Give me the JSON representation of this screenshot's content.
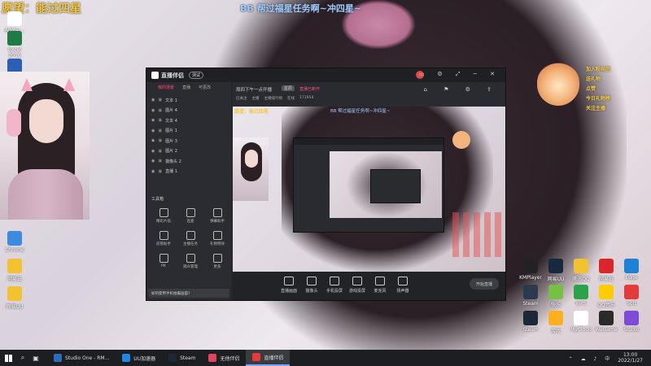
{
  "stream_overlay": {
    "wish_text": "愿望：能过四星",
    "banner_text": "BB 帮过福星任务啊~冲四星~",
    "follower_badges": [
      "加入粉丝团",
      "送礼物",
      "点赞",
      "今日礼物榜",
      "关注主播"
    ]
  },
  "desktop_icons_left": [
    {
      "label": "Adobe...",
      "color": "#ffffff"
    },
    {
      "label": "Excel 2016",
      "color": "#1f7a43"
    },
    {
      "label": "Word",
      "color": "#2b5fb5"
    },
    {
      "label": "Chrome",
      "color": "#3d8be0"
    },
    {
      "label": "网易云",
      "color": "#f3c230"
    },
    {
      "label": "网易UU",
      "color": "#f3c230"
    }
  ],
  "app": {
    "logo_text": "直播伴侣",
    "version_badge": "测试",
    "left_tabs": [
      "我的场景",
      "直播",
      "可更改"
    ],
    "sources": [
      "文本 1",
      "图片 4",
      "文本 4",
      "图片 1",
      "图片 3",
      "图片 2",
      "摄像头 2",
      "直播 1"
    ],
    "toolbox_label": "工具箱",
    "tools": [
      "精彩片段",
      "连麦",
      "弹幕助手",
      "房管助手",
      "主播任务",
      "礼物特效",
      "PK",
      "观众管理",
      "更多"
    ],
    "notice": "如何使用手机拍摄画面?",
    "room_title": "周四下午一点开播",
    "room_tag": "星辰",
    "room_status": "直播已断开",
    "room_stats": [
      "已关注",
      "主播",
      "主播排行榜",
      "在线",
      "171954"
    ],
    "bottom_buttons": [
      "直播画面",
      "摄像头",
      "手机投屏",
      "游戏投屏",
      "麦克风",
      "扬声器"
    ],
    "start_button": "开始直播"
  },
  "desktop_icons_right": [
    {
      "label": "KMPlayer",
      "color": "#222222"
    },
    {
      "label": "网易UU",
      "color": "#17293f"
    },
    {
      "label": "腾讯QQ",
      "color": "#f2c230"
    },
    {
      "label": "网易云",
      "color": "#d9252c"
    },
    {
      "label": "Edge",
      "color": "#1b82d6"
    },
    {
      "label": "Steam",
      "color": "#2a3b50"
    },
    {
      "label": "快乐",
      "color": "#76c043"
    },
    {
      "label": "WPS",
      "color": "#2aa34a"
    },
    {
      "label": "QQ音乐",
      "color": "#ffcc00"
    },
    {
      "label": "Soft",
      "color": "#e53a3a"
    },
    {
      "label": "Steam",
      "color": "#1b2838"
    },
    {
      "label": "游戏",
      "color": "#ffb020"
    },
    {
      "label": "MyCloud",
      "color": "#ffffff"
    },
    {
      "label": "WeGame",
      "color": "#2a2a2a"
    },
    {
      "label": "Studio",
      "color": "#7b4bd8"
    }
  ],
  "taskbar": {
    "items": [
      {
        "label": "Studio One - RM...",
        "color": "#2a6ebd",
        "active": false
      },
      {
        "label": "UU加速器",
        "color": "#1e88e5",
        "active": false
      },
      {
        "label": "Steam",
        "color": "#1b2838",
        "active": false
      },
      {
        "label": "无他伴侣",
        "color": "#e0455a",
        "active": false
      },
      {
        "label": "直播伴侣",
        "color": "#e53a3a",
        "active": true
      }
    ],
    "time": "13:00",
    "date": "2022/1/27"
  }
}
